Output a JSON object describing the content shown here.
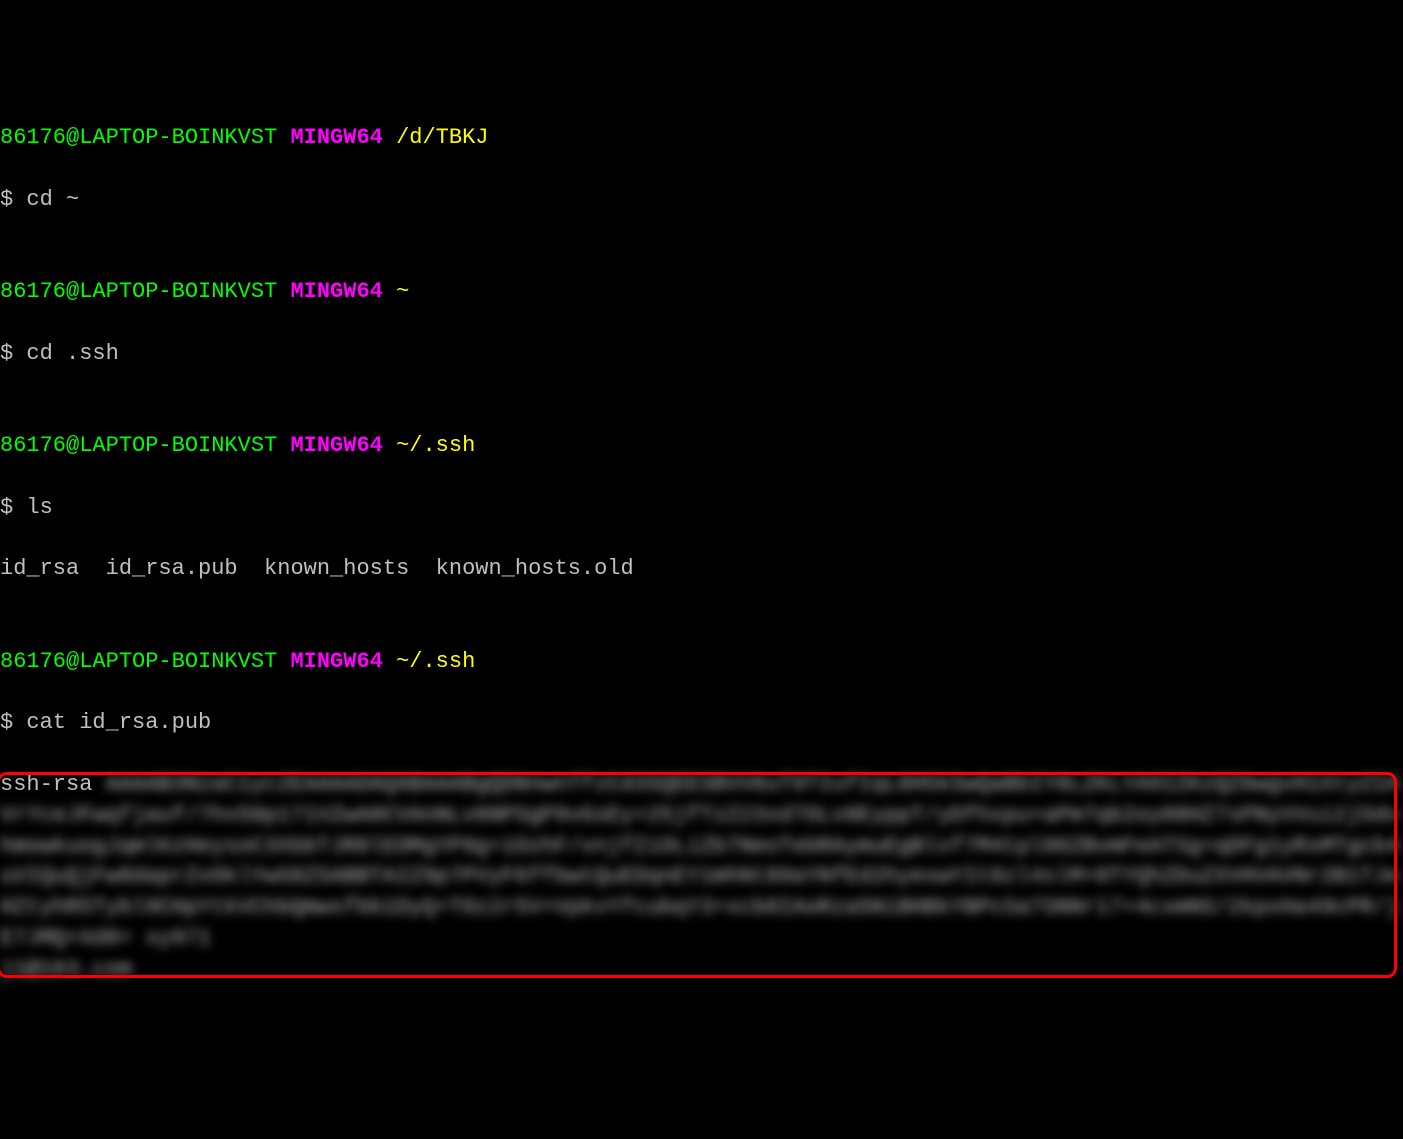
{
  "prompts": [
    {
      "user_host": "86176@LAPTOP-BOINKVST",
      "env": "MINGW64",
      "path": "/d/TBKJ",
      "symbol": "$",
      "command": "cd ~"
    },
    {
      "user_host": "86176@LAPTOP-BOINKVST",
      "env": "MINGW64",
      "path": "~",
      "symbol": "$",
      "command": "cd .ssh"
    },
    {
      "user_host": "86176@LAPTOP-BOINKVST",
      "env": "MINGW64",
      "path": "~/.ssh",
      "symbol": "$",
      "command": "ls"
    },
    {
      "user_host": "86176@LAPTOP-BOINKVST",
      "env": "MINGW64",
      "path": "~/.ssh",
      "symbol": "$",
      "command": "cat id_rsa.pub"
    }
  ],
  "ls_output": "id_rsa  id_rsa.pub  known_hosts  known_hosts.old",
  "ssh_key_prefix": "ssh-rsa",
  "ssh_key_blurred": "AAAAB3NzaC1yc2EAAAADAQABAAABgQDNnwnTfzCd3SQEESBVV6uT9TIufIqL8H5kSwQaBbIY8LZKLYA9IZKzQZ6wgvH1XtyZIAVrYceJFwqfjauf/7hv58p171VZwA0CVAnNLv6NPSgP9vGsEy+25jfTzZ23xd7OLv8EyppT/yDfhxpu+aPm7qb2oy08HZ7sPNyVVui2j5dvhmowkuogJqmlKzHeysoC3XbbTJR0lEOMgYP9g+1OzhF/vnjfZiOLiZb7NeoTebRAymuEgBlxf7M4tpl86ZBvmFeATSg+qDFg1yRsMTgcb4uVIQuQjFw8daprZvOklYwS8Z5ABBTAIZ9p7PVyF6ffbwtQuEDqnEY1mhNt89aYNfEd2hyexwYIt8zl4slM+0TYQhZDuZXVHVAVNr2B1TJeHZtyhR5Tybl9CHpYtkVChbQmwsfbb1DyQ+T0z2r5V+VpkvYfcubqY3+xcb8IAoRza5NiBHBkYBPcSa7SNNr17+4cxmNS/2kpxHa49cPR/jE7JMQ+Xd8= xy971",
  "ssh_key_suffix": "j1@163.com"
}
